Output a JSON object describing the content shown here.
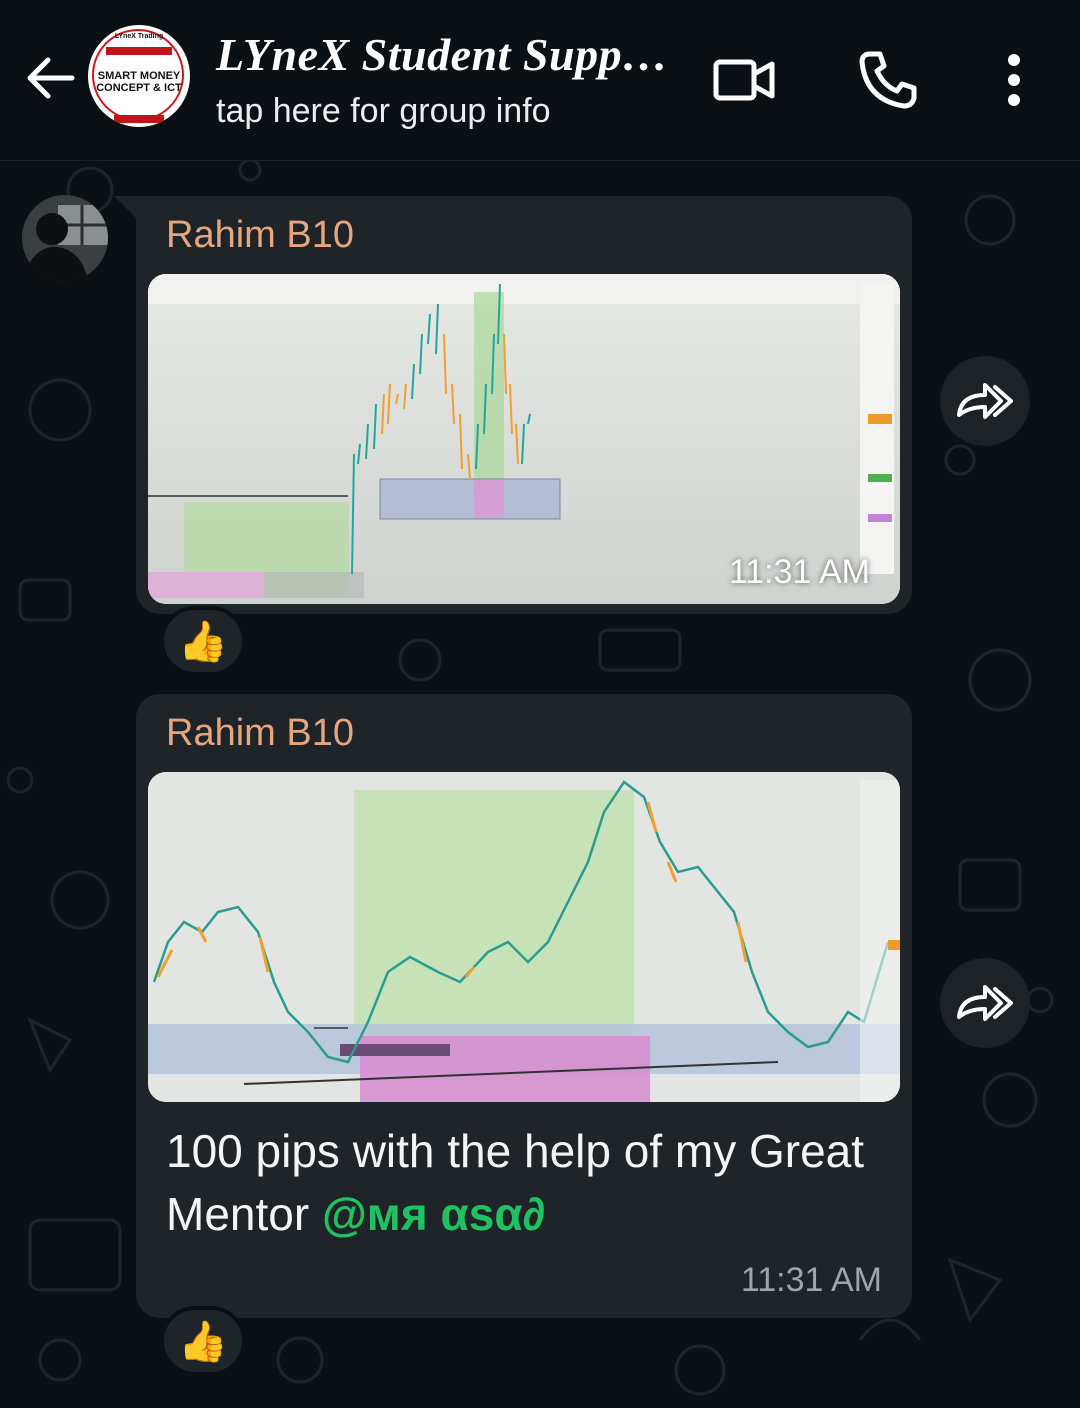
{
  "header": {
    "title": "LYneX Student Supp…",
    "subtitle": "tap here for group info",
    "avatar_logo": {
      "line1": "LYneX Trading",
      "line2": "SMART MONEY CONCEPT & ICT"
    }
  },
  "messages": [
    {
      "sender": "Rahim B10",
      "type": "image",
      "time": "11:31 AM",
      "reaction": "👍"
    },
    {
      "sender": "Rahim B10",
      "type": "image",
      "caption_text": "100 pips with the help of my Great Mentor ",
      "mention": "@мя αѕα∂",
      "time": "11:31 AM",
      "reaction": "👍"
    }
  ],
  "colors": {
    "background": "#0b1014",
    "bubble": "#1f2428",
    "sender_name": "#e5a67f",
    "mention": "#21c063",
    "icon": "#ffffff"
  },
  "icons": {
    "back": "arrow-left-icon",
    "video": "video-camera-icon",
    "call": "phone-icon",
    "menu": "more-vertical-icon",
    "forward": "forward-icon"
  }
}
